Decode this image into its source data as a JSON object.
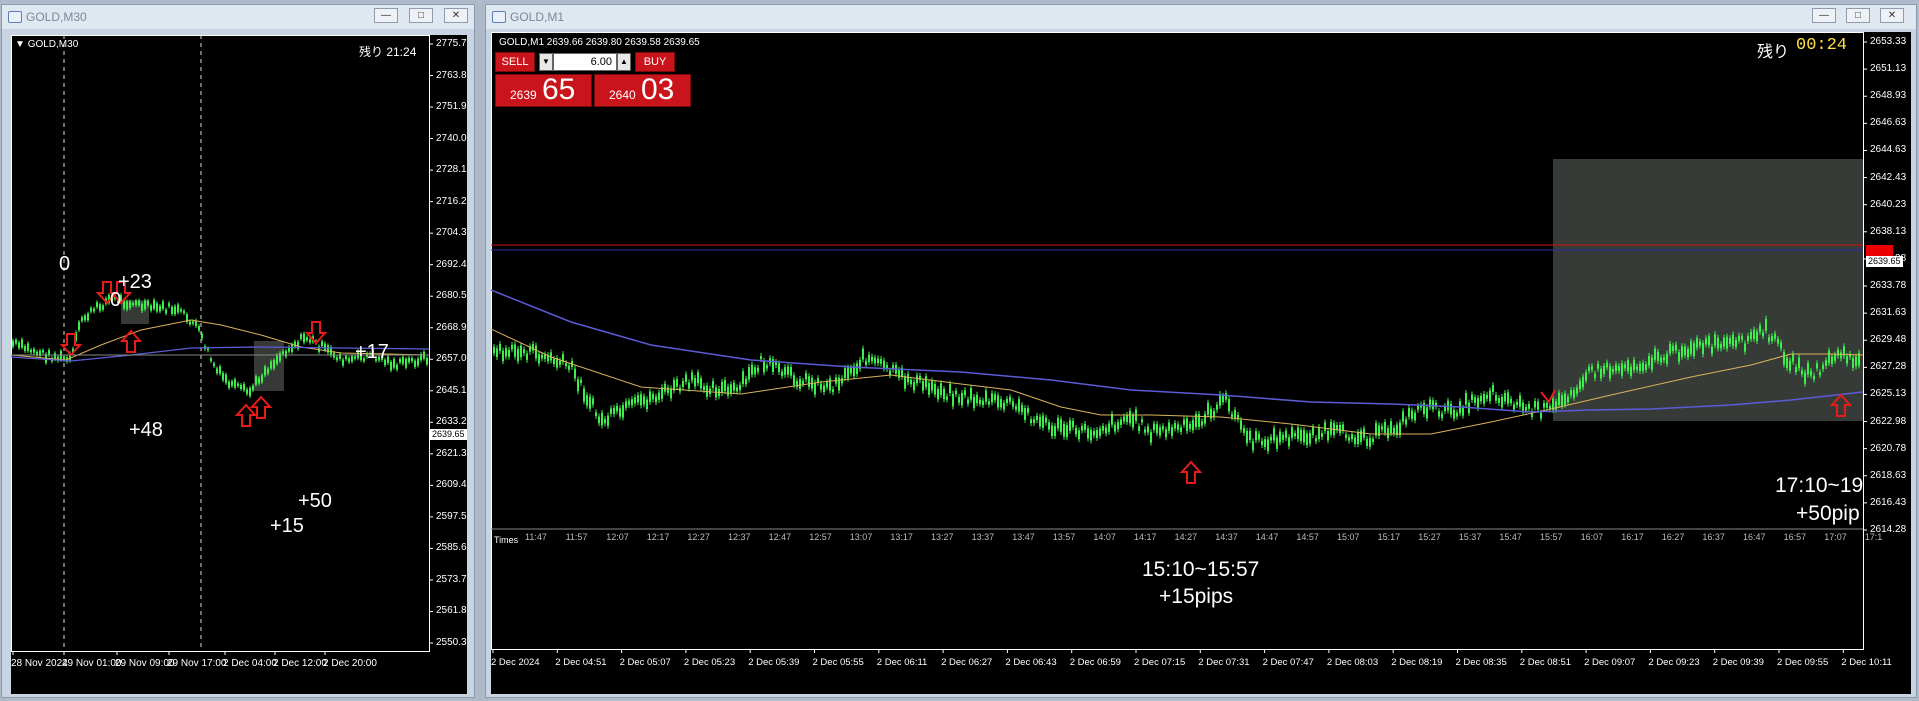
{
  "left_window": {
    "title": "GOLD,M30",
    "symbol_label": "GOLD,M30",
    "remaining": "残り 21:24",
    "price_tag": "2639.65",
    "y_labels": [
      "2775.70",
      "2763.80",
      "2751.90",
      "2740.00",
      "2728.15",
      "2716.20",
      "2704.30",
      "2692.40",
      "2680.50",
      "2668.95",
      "2657.05",
      "2645.15",
      "2633.25",
      "2621.35",
      "2609.45",
      "2597.55",
      "2585.65",
      "2573.75",
      "2561.85",
      "2550.30"
    ],
    "x_labels": [
      "28 Nov 2024",
      "29 Nov 01:00",
      "29 Nov 09:00",
      "29 Nov 17:00",
      "2 Dec 04:00",
      "2 Dec 12:00",
      "2 Dec 20:00"
    ],
    "annotations": [
      "0",
      "0",
      "+23",
      "+48",
      "+17",
      "+50",
      "+15"
    ]
  },
  "right_window": {
    "title": "GOLD,M1",
    "symbol_label": "GOLD,M1  2639.66 2639.80 2639.58 2639.65",
    "remaining_label": "残り",
    "remaining_time": "00:24",
    "trade_panel": {
      "sell_label": "SELL",
      "buy_label": "BUY",
      "volume": "6.00",
      "sell_prefix": "2639",
      "sell_big": "65",
      "buy_prefix": "2640",
      "buy_big": "03"
    },
    "price_tag": "2639.65",
    "y_labels": [
      "2653.33",
      "2651.13",
      "2648.93",
      "2646.63",
      "2644.63",
      "2642.43",
      "2640.23",
      "2638.13",
      "2635.98",
      "2633.78",
      "2631.63",
      "2629.48",
      "2627.28",
      "2625.13",
      "2622.98",
      "2620.78",
      "2618.63",
      "2616.43",
      "2614.28"
    ],
    "times_label": "Times",
    "time_labels": [
      "11:47",
      "11:57",
      "12:07",
      "12:17",
      "12:27",
      "12:37",
      "12:47",
      "12:57",
      "13:07",
      "13:17",
      "13:27",
      "13:37",
      "13:47",
      "13:57",
      "14:07",
      "14:17",
      "14:27",
      "14:37",
      "14:47",
      "14:57",
      "15:07",
      "15:17",
      "15:27",
      "15:37",
      "15:47",
      "15:57",
      "16:07",
      "16:17",
      "16:27",
      "16:37",
      "16:47",
      "16:57",
      "17:07",
      "17:1"
    ],
    "x_labels": [
      "2 Dec 2024",
      "2 Dec 04:51",
      "2 Dec 05:07",
      "2 Dec 05:23",
      "2 Dec 05:39",
      "2 Dec 05:55",
      "2 Dec 06:11",
      "2 Dec 06:27",
      "2 Dec 06:43",
      "2 Dec 06:59",
      "2 Dec 07:15",
      "2 Dec 07:31",
      "2 Dec 07:47",
      "2 Dec 08:03",
      "2 Dec 08:19",
      "2 Dec 08:35",
      "2 Dec 08:51",
      "2 Dec 09:07",
      "2 Dec 09:23",
      "2 Dec 09:39",
      "2 Dec 09:55",
      "2 Dec 10:11"
    ],
    "annotation_1_time": "15:10~15:57",
    "annotation_1_pips": "+15pips",
    "annotation_2_time": "17:10~19",
    "annotation_2_pips": "+50pip"
  },
  "colors": {
    "candle": "#3bf04a",
    "ma_fast": "#d8b35a",
    "ma_slow": "#5b5bd6",
    "arrow": "#e81b1b",
    "sell_buy_bg": "#c9141b",
    "price_line_red": "#d01010",
    "price_line_blue": "#2a2ab0"
  }
}
